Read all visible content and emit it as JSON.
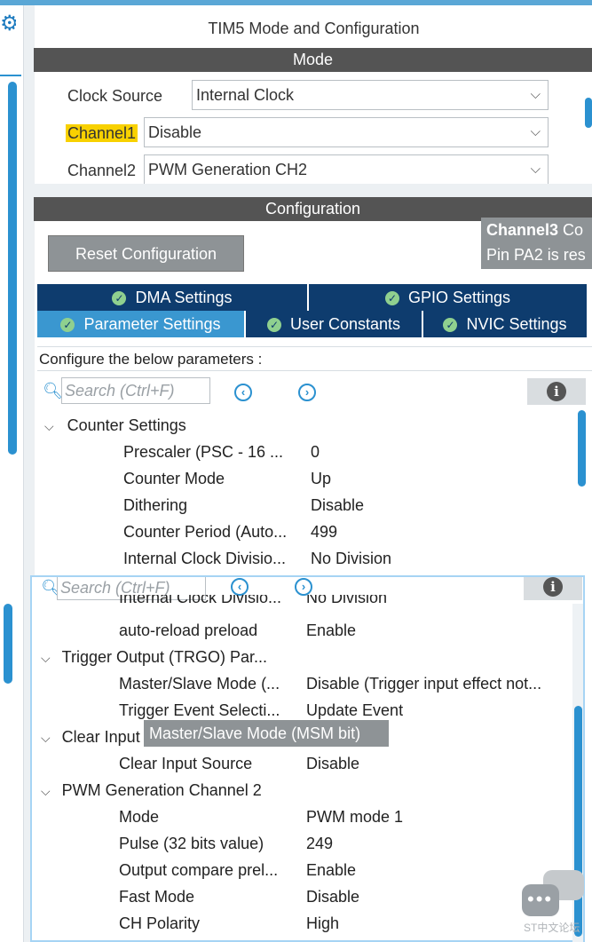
{
  "window": {
    "title": "TIM5 Mode and Configuration"
  },
  "mode": {
    "header": "Mode",
    "clock_source": {
      "label": "Clock Source",
      "value": "Internal Clock"
    },
    "channel1": {
      "label": "Channel1",
      "value": "Disable"
    },
    "channel2": {
      "label": "Channel2",
      "value": "PWM Generation CH2"
    }
  },
  "configuration": {
    "header": "Configuration",
    "reset_button": "Reset Configuration",
    "side_tooltip": {
      "line1_bold": "Channel3",
      "line1_rest": " Co",
      "line2": "Pin PA2 is res"
    },
    "tabs_row1": [
      "DMA Settings",
      "GPIO Settings"
    ],
    "tabs_row2": [
      "Parameter Settings",
      "User Constants",
      "NVIC Settings"
    ],
    "active_tab": "Parameter Settings",
    "configure_label": "Configure the below parameters :"
  },
  "search": {
    "placeholder": "Search (Ctrl+F)",
    "prev_icon": "chevron-left-circle-icon",
    "next_icon": "chevron-right-circle-icon",
    "info_icon": "info-icon"
  },
  "params_top": {
    "group": "Counter Settings",
    "rows": [
      {
        "k": "Prescaler (PSC - 16 ...",
        "v": "0"
      },
      {
        "k": "Counter Mode",
        "v": "Up"
      },
      {
        "k": "Dithering",
        "v": "Disable"
      },
      {
        "k": "Counter Period (Auto...",
        "v": "499"
      },
      {
        "k": "Internal Clock Divisio...",
        "v": "No Division"
      }
    ]
  },
  "params_overlay": {
    "partial_row": {
      "k": "Internal Clock Divisio...",
      "v": "No Division"
    },
    "rows_before_trgo": [
      {
        "k": "auto-reload preload",
        "v": "Enable"
      }
    ],
    "trgo_group": "Trigger Output (TRGO) Par...",
    "trgo_rows": [
      {
        "k": "Master/Slave Mode (...",
        "v": "Disable (Trigger input effect not..."
      },
      {
        "k": "Trigger Event Selecti...",
        "v": "Update Event"
      }
    ],
    "clear_group": "Clear Input",
    "clear_rows": [
      {
        "k": "Clear Input Source",
        "v": "Disable"
      }
    ],
    "pwm_group": "PWM Generation Channel 2",
    "pwm_rows": [
      {
        "k": "Mode",
        "v": "PWM mode 1"
      },
      {
        "k": "Pulse (32 bits value)",
        "v": "249"
      },
      {
        "k": "Output compare prel...",
        "v": "Enable"
      },
      {
        "k": "Fast Mode",
        "v": "Disable"
      },
      {
        "k": "CH Polarity",
        "v": "High"
      }
    ],
    "tooltip": "Master/Slave Mode (MSM bit)"
  },
  "watermark": "ST中文论坛",
  "colors": {
    "accent": "#2b91d0",
    "tab_dark": "#0e3c6e",
    "tab_active": "#3a97d0",
    "highlight": "#f8d100",
    "bar": "#545454"
  }
}
